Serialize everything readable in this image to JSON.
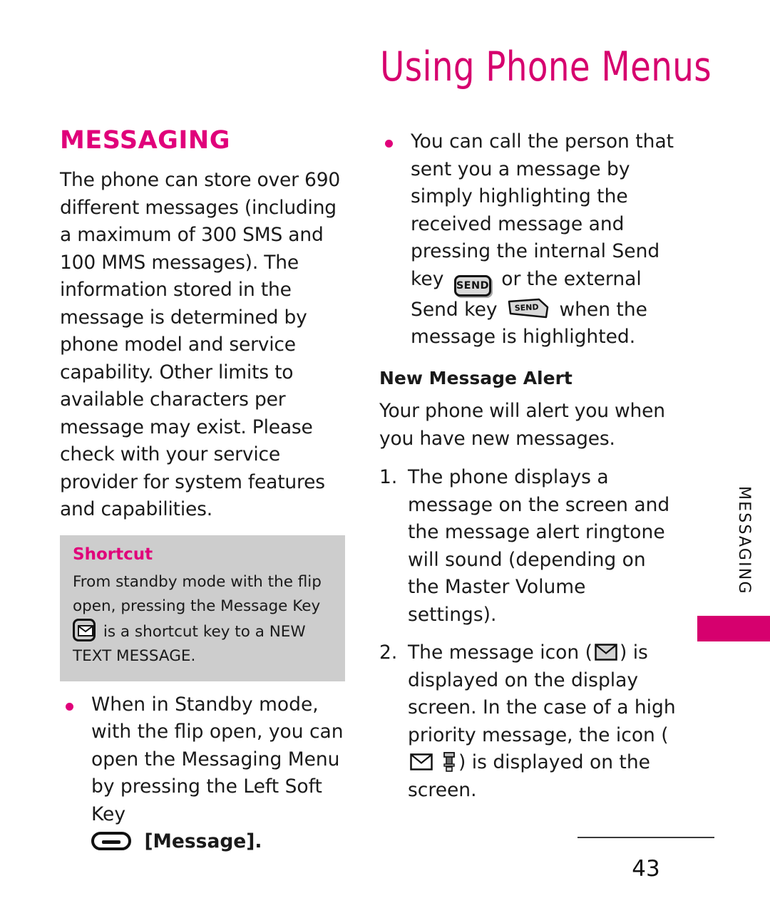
{
  "header": {
    "title": "Using Phone Menus"
  },
  "colors": {
    "accent_pink": "#D6006E",
    "heading_pink": "#E0007A",
    "callout_bg": "#cdcdcd",
    "text": "#1a1a1a"
  },
  "left_column": {
    "section_title": "MESSAGING",
    "intro": "The phone can store over 690 different messages (including a maximum of 300 SMS and 100 MMS messages). The information stored in the message is determined by phone model and service capability. Other limits to available characters per message may exist. Please check with your service provider for system features and capabilities.",
    "shortcut": {
      "title": "Shortcut",
      "text_before_icon": "From standby mode with the flip open, pressing the Message Key",
      "icon": "message-key-icon",
      "text_after_icon": "is a shortcut key to a NEW TEXT MESSAGE."
    },
    "bullets": [
      {
        "text_before_icon": "When in Standby mode, with the flip open, you can open the Messaging Menu by pressing the Left Soft Key",
        "icon": "left-soft-key-icon",
        "text_after_icon": "[Message]."
      }
    ]
  },
  "right_column": {
    "bullets": [
      {
        "text_part_1": "You can call the person that sent you a message by simply highlighting the received message and pressing the internal Send key",
        "icon_1": "internal-send-key-icon",
        "icon_1_label": "SEND",
        "text_part_2": "or the external Send key",
        "icon_2": "external-send-key-icon",
        "icon_2_label": "SEND",
        "text_part_3": "when the message is highlighted."
      }
    ],
    "sub_head": "New Message Alert",
    "alert_intro": "Your phone will alert you when you have new messages.",
    "steps": [
      {
        "number": "1.",
        "text": "The phone displays a message on the screen and the message alert ringtone will sound (depending on the Master Volume settings)."
      },
      {
        "number": "2.",
        "text_part_1": "The message icon (",
        "icon_1": "envelope-icon",
        "text_part_2": ") is displayed on the display screen. In the case of a high priority message, the icon (",
        "icon_2": "envelope-icon",
        "icon_3": "high-priority-icon",
        "text_part_3": ") is displayed on the screen."
      }
    ]
  },
  "side_tab": {
    "label": "MESSAGING"
  },
  "footer": {
    "page_number": "43"
  }
}
